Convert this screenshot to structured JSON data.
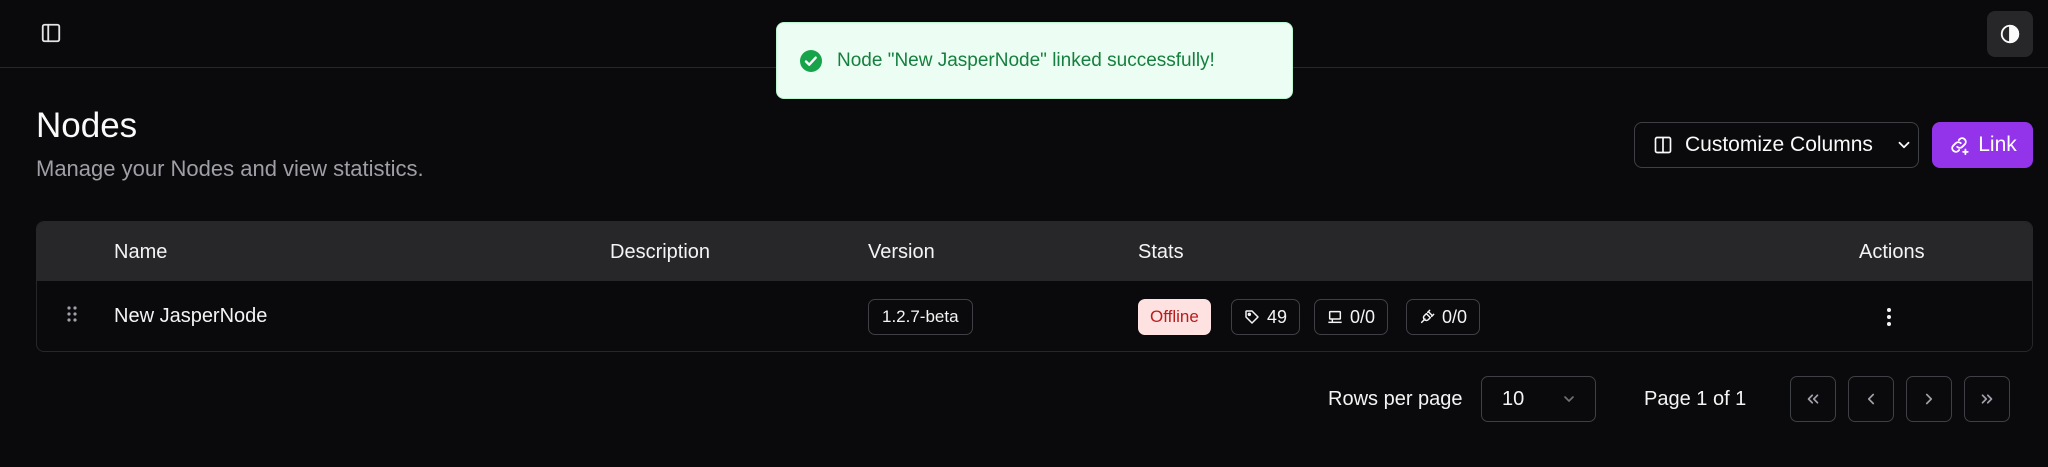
{
  "toast": {
    "message": "Node \"New JasperNode\" linked successfully!"
  },
  "header": {
    "title": "Nodes",
    "subtitle": "Manage your Nodes and view statistics.",
    "customize_label": "Customize Columns",
    "link_label": "Link"
  },
  "table": {
    "columns": [
      "Name",
      "Description",
      "Version",
      "Stats",
      "Actions"
    ],
    "rows": [
      {
        "name": "New JasperNode",
        "description": "",
        "version": "1.2.7-beta",
        "status": "Offline",
        "tags": "49",
        "servers": "0/0",
        "allocations": "0/0"
      }
    ]
  },
  "pagination": {
    "rows_per_page_label": "Rows per page",
    "rows_per_page_value": "10",
    "page_info": "Page 1 of 1"
  },
  "colors": {
    "background": "#0a0a0c",
    "accent": "#9333ea",
    "toast_bg": "#ecfdf3",
    "toast_text": "#15803d",
    "offline_bg": "#fee2e2",
    "offline_text": "#b91c1c"
  },
  "icons": [
    "sidebar-toggle-icon",
    "theme-toggle-icon",
    "check-circle-icon",
    "columns-icon",
    "chevron-down-icon",
    "link-icon",
    "grip-icon",
    "tag-icon",
    "server-icon",
    "plug-icon",
    "more-vertical-icon",
    "chevrons-left-icon",
    "chevron-left-icon",
    "chevron-right-icon",
    "chevrons-right-icon"
  ]
}
